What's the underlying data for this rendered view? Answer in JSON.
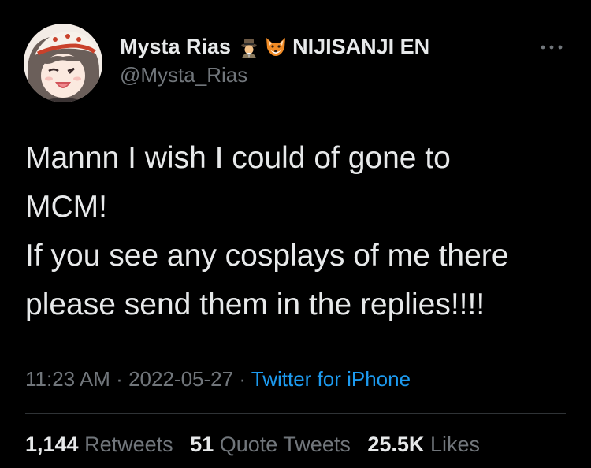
{
  "tweet": {
    "author": {
      "display_name": "Mysta Rias",
      "emoji_1": "detective-emoji",
      "emoji_2": "fox-emoji",
      "affiliation": "NIJISANJI EN",
      "handle": "@Mysta_Rias"
    },
    "text_lines": [
      "Mannn I wish I could of gone to",
      "MCM!",
      "If you see any cosplays of me there",
      "please send them in the replies!!!!"
    ],
    "time": "11:23 AM",
    "separator": "·",
    "date": "2022-05-27",
    "source": "Twitter for iPhone",
    "stats": {
      "retweets_count": "1,144",
      "retweets_label": "Retweets",
      "quotes_count": "51",
      "quotes_label": "Quote Tweets",
      "likes_count": "25.5K",
      "likes_label": "Likes"
    }
  },
  "colors": {
    "background": "#000000",
    "text_primary": "#e7e9ea",
    "text_secondary": "#71767b",
    "link": "#1d9bf0",
    "divider": "#2f3336"
  }
}
